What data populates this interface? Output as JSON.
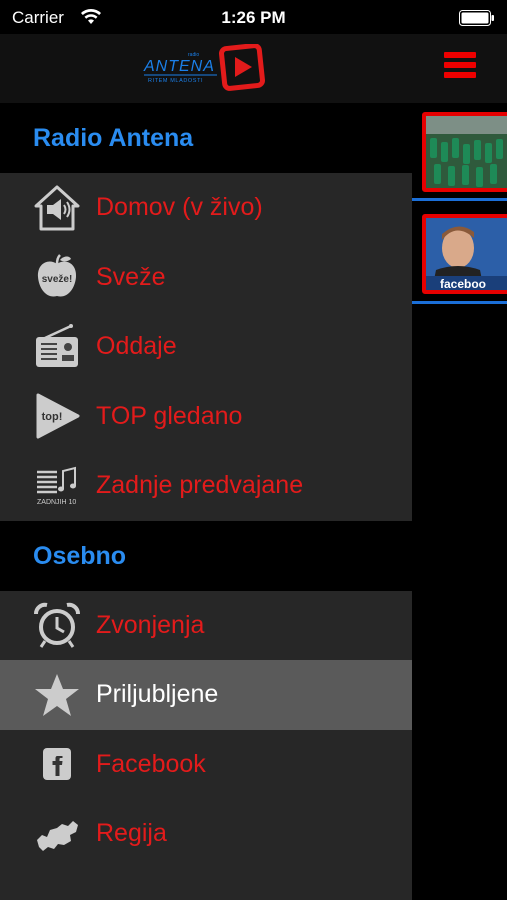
{
  "status_bar": {
    "carrier": "Carrier",
    "time": "1:26 PM"
  },
  "header": {
    "logo_text": "ANTENA",
    "logo_subtext": "RITEM MLADOSTI",
    "logo_prefix": "radio",
    "accent_color": "#e31b1b"
  },
  "menu": {
    "sections": [
      {
        "title": "Radio Antena",
        "items": [
          {
            "label": "Domov (v živo)",
            "icon": "home-speaker-icon"
          },
          {
            "label": "Sveže",
            "icon": "apple-icon",
            "icon_text": "sveže!"
          },
          {
            "label": "Oddaje",
            "icon": "radio-icon"
          },
          {
            "label": "TOP gledano",
            "icon": "top-play-icon",
            "icon_text": "top!"
          },
          {
            "label": "Zadnje predvajane",
            "icon": "playlist-icon",
            "icon_text": "ZADNJIH 10"
          }
        ]
      },
      {
        "title": "Osebno",
        "items": [
          {
            "label": "Zvonjenja",
            "icon": "alarm-clock-icon"
          },
          {
            "label": "Priljubljene",
            "icon": "star-icon",
            "selected": true
          },
          {
            "label": "Facebook",
            "icon": "facebook-icon"
          },
          {
            "label": "Regija",
            "icon": "slovenia-map-icon"
          }
        ]
      }
    ]
  },
  "content": {
    "thumbnails": [
      {
        "name": "video-thumbnail-bottles"
      },
      {
        "name": "video-thumbnail-facebook",
        "caption": "faceboo"
      }
    ]
  }
}
